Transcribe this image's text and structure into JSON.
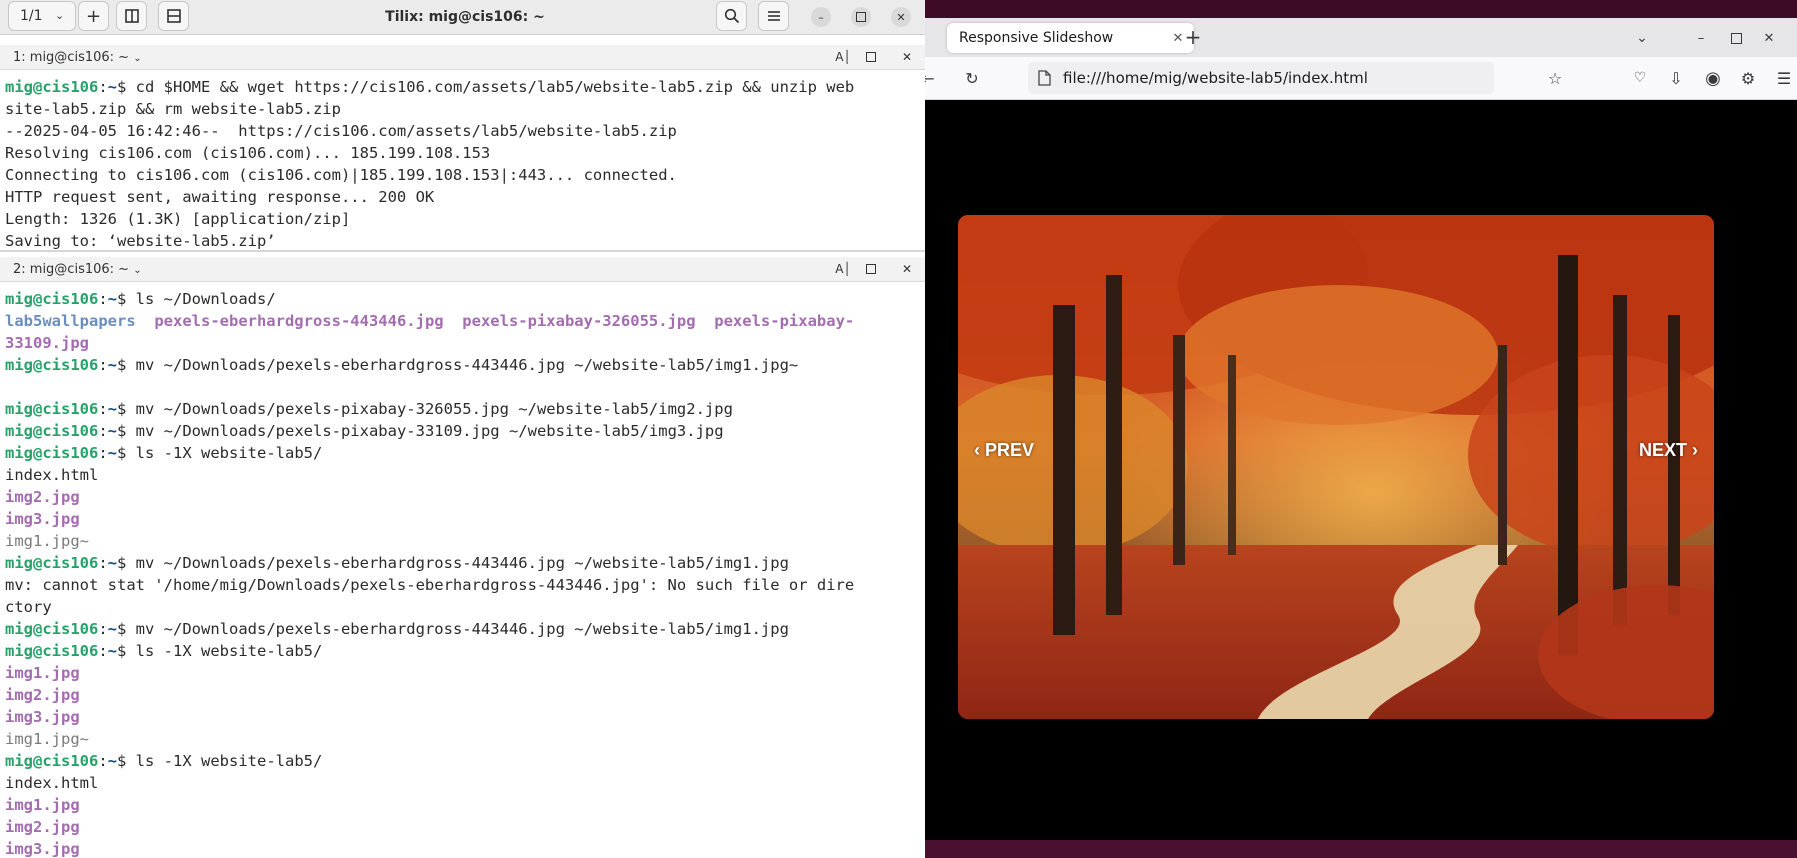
{
  "tilix": {
    "session_count": "1/1",
    "title": "Tilix: mig@cis106: ~",
    "pane1_label": "1: mig@cis106: ~",
    "pane2_label": "2: mig@cis106: ~",
    "pane1_lines": [
      [
        {
          "t": "mig@cis106",
          "c": "pu"
        },
        {
          "t": ":",
          "c": ""
        },
        {
          "t": "~",
          "c": "pp"
        },
        {
          "t": "$ cd $HOME && wget https://cis106.com/assets/lab5/website-lab5.zip && unzip web",
          "c": ""
        }
      ],
      [
        {
          "t": "site-lab5.zip && rm website-lab5.zip",
          "c": ""
        }
      ],
      [
        {
          "t": "--2025-04-05 16:42:46--  https://cis106.com/assets/lab5/website-lab5.zip",
          "c": ""
        }
      ],
      [
        {
          "t": "Resolving cis106.com (cis106.com)... 185.199.108.153",
          "c": ""
        }
      ],
      [
        {
          "t": "Connecting to cis106.com (cis106.com)|185.199.108.153|:443... connected.",
          "c": ""
        }
      ],
      [
        {
          "t": "HTTP request sent, awaiting response... 200 OK",
          "c": ""
        }
      ],
      [
        {
          "t": "Length: 1326 (1.3K) [application/zip]",
          "c": ""
        }
      ],
      [
        {
          "t": "Saving to: ‘website-lab5.zip’",
          "c": ""
        }
      ]
    ],
    "pane2_lines": [
      [
        {
          "t": "mig@cis106",
          "c": "pu"
        },
        {
          "t": ":",
          "c": ""
        },
        {
          "t": "~",
          "c": "pp"
        },
        {
          "t": "$ ls ~/Downloads/",
          "c": ""
        }
      ],
      [
        {
          "t": "lab5wallpapers",
          "c": "dir"
        },
        {
          "t": "  ",
          "c": ""
        },
        {
          "t": "pexels-eberhardgross-443446.jpg",
          "c": "img"
        },
        {
          "t": "  ",
          "c": ""
        },
        {
          "t": "pexels-pixabay-326055.jpg",
          "c": "img"
        },
        {
          "t": "  ",
          "c": ""
        },
        {
          "t": "pexels-pixabay-",
          "c": "img"
        }
      ],
      [
        {
          "t": "33109.jpg",
          "c": "img"
        }
      ],
      [
        {
          "t": "mig@cis106",
          "c": "pu"
        },
        {
          "t": ":",
          "c": ""
        },
        {
          "t": "~",
          "c": "pp"
        },
        {
          "t": "$ mv ~/Downloads/pexels-eberhardgross-443446.jpg ~/website-lab5/img1.jpg~",
          "c": ""
        }
      ],
      [],
      [
        {
          "t": "mig@cis106",
          "c": "pu"
        },
        {
          "t": ":",
          "c": ""
        },
        {
          "t": "~",
          "c": "pp"
        },
        {
          "t": "$ mv ~/Downloads/pexels-pixabay-326055.jpg ~/website-lab5/img2.jpg",
          "c": ""
        }
      ],
      [
        {
          "t": "mig@cis106",
          "c": "pu"
        },
        {
          "t": ":",
          "c": ""
        },
        {
          "t": "~",
          "c": "pp"
        },
        {
          "t": "$ mv ~/Downloads/pexels-pixabay-33109.jpg ~/website-lab5/img3.jpg",
          "c": ""
        }
      ],
      [
        {
          "t": "mig@cis106",
          "c": "pu"
        },
        {
          "t": ":",
          "c": ""
        },
        {
          "t": "~",
          "c": "pp"
        },
        {
          "t": "$ ls -1X website-lab5/",
          "c": ""
        }
      ],
      [
        {
          "t": "index.html",
          "c": ""
        }
      ],
      [
        {
          "t": "img2.jpg",
          "c": "img"
        }
      ],
      [
        {
          "t": "img3.jpg",
          "c": "img"
        }
      ],
      [
        {
          "t": "img1.jpg~",
          "c": "bk"
        }
      ],
      [
        {
          "t": "mig@cis106",
          "c": "pu"
        },
        {
          "t": ":",
          "c": ""
        },
        {
          "t": "~",
          "c": "pp"
        },
        {
          "t": "$ mv ~/Downloads/pexels-eberhardgross-443446.jpg ~/website-lab5/img1.jpg",
          "c": ""
        }
      ],
      [
        {
          "t": "mv: cannot stat '/home/mig/Downloads/pexels-eberhardgross-443446.jpg': No such file or dire",
          "c": ""
        }
      ],
      [
        {
          "t": "ctory",
          "c": ""
        }
      ],
      [
        {
          "t": "mig@cis106",
          "c": "pu"
        },
        {
          "t": ":",
          "c": ""
        },
        {
          "t": "~",
          "c": "pp"
        },
        {
          "t": "$ mv ~/Downloads/pexels-eberhardgross-443446.jpg ~/website-lab5/img1.jpg",
          "c": ""
        }
      ],
      [
        {
          "t": "mig@cis106",
          "c": "pu"
        },
        {
          "t": ":",
          "c": ""
        },
        {
          "t": "~",
          "c": "pp"
        },
        {
          "t": "$ ls -1X website-lab5/",
          "c": ""
        }
      ],
      [
        {
          "t": "img1.jpg",
          "c": "img"
        }
      ],
      [
        {
          "t": "img2.jpg",
          "c": "img"
        }
      ],
      [
        {
          "t": "img3.jpg",
          "c": "img"
        }
      ],
      [
        {
          "t": "img1.jpg~",
          "c": "bk"
        }
      ],
      [
        {
          "t": "mig@cis106",
          "c": "pu"
        },
        {
          "t": ":",
          "c": ""
        },
        {
          "t": "~",
          "c": "pp"
        },
        {
          "t": "$ ls -1X website-lab5/",
          "c": ""
        }
      ],
      [
        {
          "t": "index.html",
          "c": ""
        }
      ],
      [
        {
          "t": "img1.jpg",
          "c": "img"
        }
      ],
      [
        {
          "t": "img2.jpg",
          "c": "img"
        }
      ],
      [
        {
          "t": "img3.jpg",
          "c": "img"
        }
      ]
    ]
  },
  "browser": {
    "tab_title": "Responsive Slideshow",
    "url": "file:///home/mig/website-lab5/index.html",
    "slideshow": {
      "prev_label": "‹ PREV",
      "next_label": "NEXT ›"
    }
  }
}
